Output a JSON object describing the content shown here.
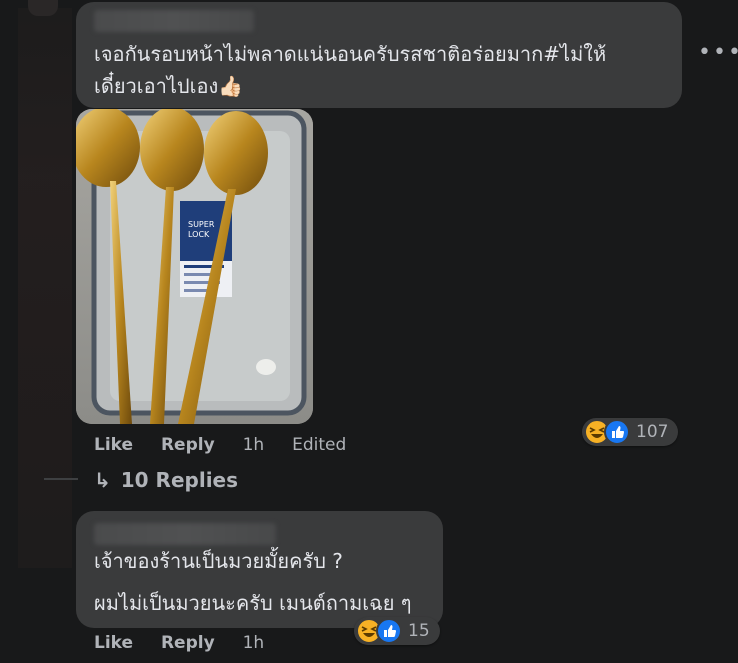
{
  "comment1": {
    "text_line1": "เจอกันรอบหน้าไม่พลาดแน่นอนครับรสชาติอร่อยมาก#ไม่ให้",
    "text_line2": "เดี๋ยวเอาไปเอง👍🏻",
    "more_icon": "more-options-icon",
    "photo_label_line1": "SUPER",
    "photo_label_line2": "LOCK",
    "actions": {
      "like": "Like",
      "reply": "Reply",
      "time": "1h",
      "edited": "Edited"
    },
    "reactions": {
      "icons": [
        "laughing-emoji-icon",
        "like-thumb-icon"
      ],
      "count": "107"
    },
    "replies": {
      "arrow": "↳",
      "label": "10 Replies"
    }
  },
  "comment2": {
    "text_line1": "เจ้าของร้านเป็นมวยมั้ยครับ ?",
    "text_line2": "ผมไม่เป็นมวยนะครับ เมนต์ถามเฉย ๆ",
    "actions": {
      "like": "Like",
      "reply": "Reply",
      "time": "1h"
    },
    "reactions": {
      "icons": [
        "laughing-emoji-icon",
        "like-thumb-icon"
      ],
      "count": "15"
    }
  },
  "colors": {
    "background": "#18191a",
    "bubble": "#3a3b3c",
    "text": "#e4e6eb",
    "muted": "#b0b3b8",
    "like_blue": "#1877f2",
    "haha_yellow": "#f7b125"
  }
}
